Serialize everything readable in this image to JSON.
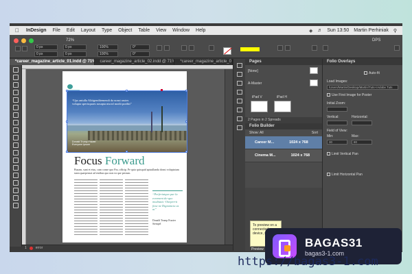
{
  "menubar": {
    "app_name": "InDesign",
    "items": [
      "File",
      "Edit",
      "Layout",
      "Type",
      "Object",
      "Table",
      "View",
      "Window",
      "Help"
    ],
    "clock": "Sun 13:50",
    "user": "Martin Perhiniak"
  },
  "control_bar": {
    "zoom": "72%",
    "workspace": "DPS",
    "field_values": [
      "0 px",
      "0 px",
      "0 px",
      "0 px",
      "100%",
      "100%",
      "0°",
      "0°"
    ]
  },
  "document_tabs": [
    "*career_magazine_article_01.indd @ 71%",
    "career_magazine_article_02.indd @ 71%",
    "*career_magazine_article_0"
  ],
  "document": {
    "headline_part1": "Focus",
    "headline_part2": "Forward",
    "photo_quote": "“Ups aniulla Alitigenditemendi da nonsi rautes volupta sperisquaes nosapta niscid modit poribit”",
    "photo_caption": "Donald Trump Frazier Everyone Ipsum",
    "deck": "Busam, sunt et eius, cum conse quo Fin, officip. Pe quia quisquid apisullanda donsi voluptatum stam quaepernat ad entibus quo non ea que perrum.",
    "pull_quote": "“Perferiatquo par la ecrement do-quo moditatis -Oneperrit fiaw ne Dignamcia as nt”",
    "byline": "Donald Trump Frazier Stempel"
  },
  "status_bar": {
    "page": "1",
    "errors": "error"
  },
  "pages_panel": {
    "title": "Pages",
    "none_label": "[None]",
    "master_label": "A-Master",
    "devices": [
      "iPad V",
      "iPad H"
    ],
    "footer": "2 Pages in 2 Spreads"
  },
  "folio_builder": {
    "title": "Folio Builder",
    "filter": "Show: All",
    "sort": "Sort",
    "rows": [
      {
        "name": "Career M...",
        "size": "1024 x 768"
      },
      {
        "name": "Cinema M...",
        "size": "1024 x 768"
      }
    ]
  },
  "folio_overlays": {
    "title": "Folio Overlays",
    "auto_fit": "Auto-fit",
    "load_images_label": "Load Images:",
    "load_images_path": "/Users/Martin/Desktop/Martin/Tuts+/Adobe Tuts",
    "use_first_image": "Use First Image for Poster",
    "initial_zoom": "Initial Zoom:",
    "vertical": "Vertical:",
    "horizontal": "Horizontal:",
    "field_of_view": "Field of View:",
    "min": "Min:",
    "max": "Max:",
    "min_value": "30",
    "max_value": "80",
    "limit_vertical": "Limit Vertical Pan",
    "limit_horizontal": "Limit Horizontal Pan"
  },
  "tooltip": {
    "text": "To preview on a connected device, select...",
    "after": "Preview"
  },
  "watermark": {
    "title": "BAGAS31",
    "subtitle": "bagas3-1.com",
    "url": "https://bagas3-1.com"
  },
  "colors": {
    "accent_teal": "#3b9b8d",
    "selection_blue": "#4a7ae0",
    "folio_selected": "#5f7fa7",
    "watermark_bg": "#1e2236"
  }
}
